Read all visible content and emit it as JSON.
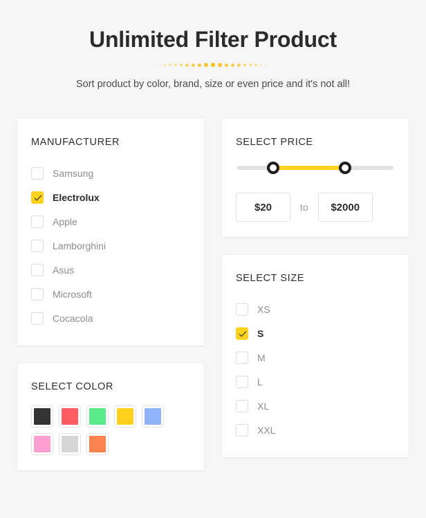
{
  "header": {
    "title": "Unlimited Filter Product",
    "subtitle": "Sort product by color, brand, size or even price and it's not all!",
    "divider_color": "#f5c21c"
  },
  "accent_color": "#ffd21e",
  "manufacturer": {
    "title": "MANUFACTURER",
    "options": [
      {
        "label": "Samsung",
        "checked": false
      },
      {
        "label": "Electrolux",
        "checked": true
      },
      {
        "label": "Apple",
        "checked": false
      },
      {
        "label": "Lamborghini",
        "checked": false
      },
      {
        "label": "Asus",
        "checked": false
      },
      {
        "label": "Microsoft",
        "checked": false
      },
      {
        "label": "Cocacola",
        "checked": false
      }
    ]
  },
  "price": {
    "title": "SELECT PRICE",
    "min_value": "$20",
    "max_value": "$2000",
    "separator_label": "to",
    "slider": {
      "low_percent": 23,
      "high_percent": 69,
      "track_color": "#e2e2e2",
      "range_color": "#ffd21e",
      "handle_border_color": "#1c1c1c"
    }
  },
  "size": {
    "title": "SELECT SIZE",
    "options": [
      {
        "label": "XS",
        "checked": false
      },
      {
        "label": "S",
        "checked": true
      },
      {
        "label": "M",
        "checked": false
      },
      {
        "label": "L",
        "checked": false
      },
      {
        "label": "XL",
        "checked": false
      },
      {
        "label": "XXL",
        "checked": false
      }
    ]
  },
  "color": {
    "title": "SELECT COLOR",
    "swatches": [
      {
        "name": "charcoal",
        "hex": "#333333"
      },
      {
        "name": "red",
        "hex": "#fc5c62"
      },
      {
        "name": "green",
        "hex": "#5ceb8a"
      },
      {
        "name": "yellow",
        "hex": "#ffd21e"
      },
      {
        "name": "blue",
        "hex": "#8fb4fb"
      },
      {
        "name": "pink",
        "hex": "#ffa0d0"
      },
      {
        "name": "gray",
        "hex": "#d6d6d6"
      },
      {
        "name": "orange",
        "hex": "#fd8350"
      }
    ]
  }
}
